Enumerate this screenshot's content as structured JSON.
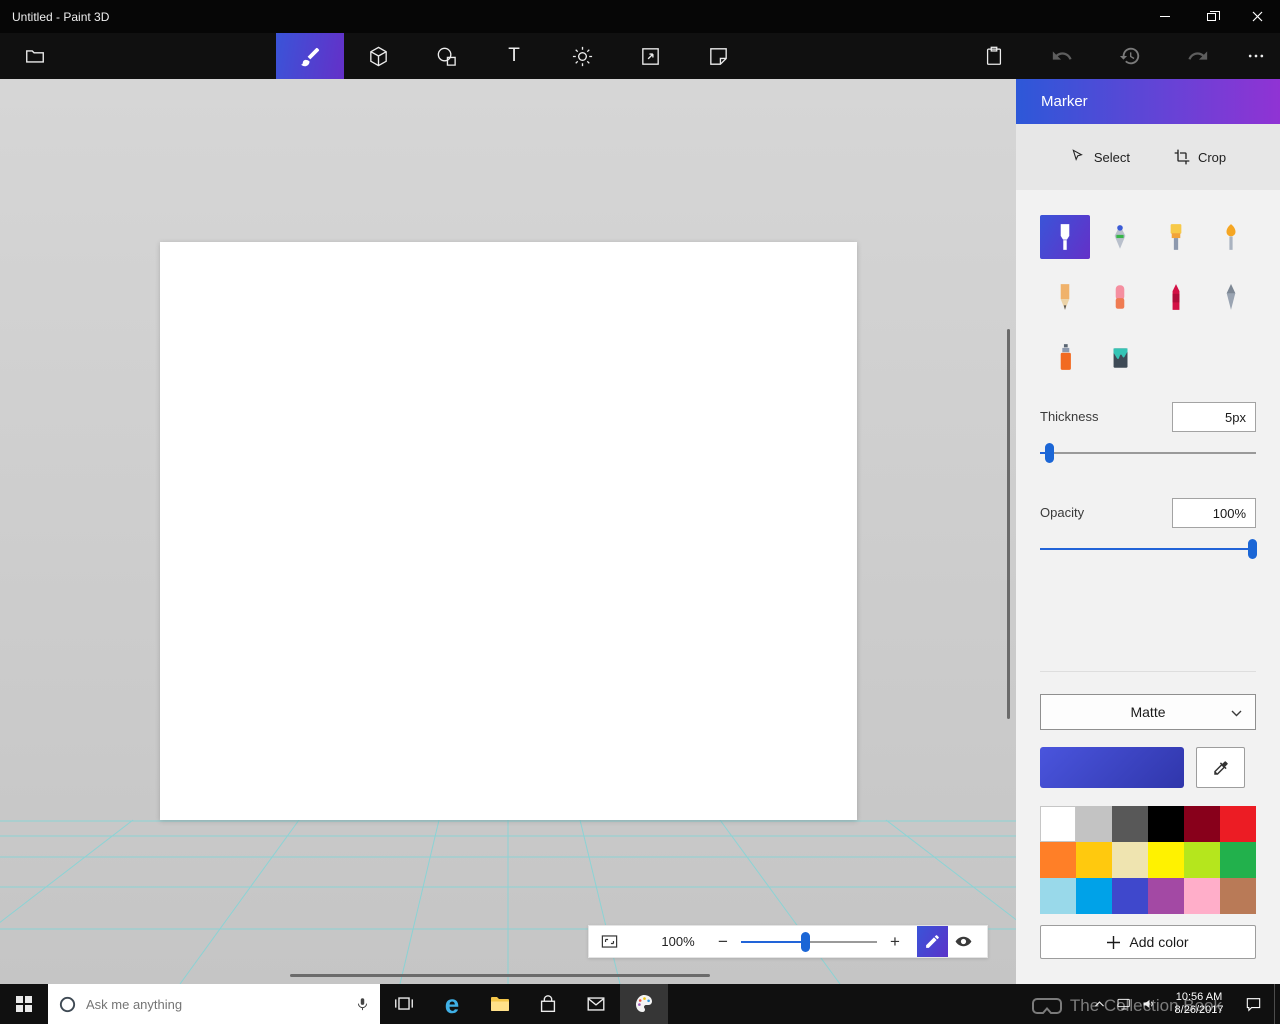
{
  "colors": {
    "accent_gradient_from": "#3a54d8",
    "accent_gradient_to": "#6430c8",
    "header_gradient_from": "#2d58d8",
    "header_gradient_to": "#9033d4",
    "current_color_from": "#4a55dd",
    "current_color_to": "#3036ab",
    "slider_accent": "#2264d8",
    "grid_line_color": "#52dfe2",
    "taskbar_bg": "#101010"
  },
  "titlebar": {
    "title": "Untitled - Paint 3D"
  },
  "toolbar": {
    "tools": [
      {
        "name": "Brushes",
        "selected": true
      },
      {
        "name": "3D shapes",
        "selected": false
      },
      {
        "name": "2D shapes",
        "selected": false
      },
      {
        "name": "Text",
        "selected": false
      },
      {
        "name": "Effects",
        "selected": false
      },
      {
        "name": "Canvas",
        "selected": false
      },
      {
        "name": "Stickers",
        "selected": false
      }
    ],
    "text_tool_glyph": "T",
    "actions": [
      "Paste",
      "Undo",
      "History",
      "Redo",
      "More"
    ]
  },
  "panel": {
    "title": "Marker",
    "select_label": "Select",
    "crop_label": "Crop",
    "brushes": [
      {
        "name": "Marker",
        "selected": true
      },
      {
        "name": "Calligraphy pen",
        "selected": false
      },
      {
        "name": "Oil brush",
        "selected": false
      },
      {
        "name": "Watercolour",
        "selected": false
      },
      {
        "name": "Pencil",
        "selected": false
      },
      {
        "name": "Eraser",
        "selected": false
      },
      {
        "name": "Crayon",
        "selected": false
      },
      {
        "name": "Pixel pen",
        "selected": false
      },
      {
        "name": "Spray can",
        "selected": false
      },
      {
        "name": "Fill",
        "selected": false
      }
    ],
    "thickness": {
      "label": "Thickness",
      "value": "5px",
      "percent": "4%"
    },
    "opacity": {
      "label": "Opacity",
      "value": "100%",
      "percent": "100%"
    },
    "finish": {
      "value": "Matte"
    },
    "palette": [
      {
        "name": "white",
        "hex": "#FFFFFF"
      },
      {
        "name": "light-grey",
        "hex": "#C3C3C3"
      },
      {
        "name": "dark-grey",
        "hex": "#585858"
      },
      {
        "name": "black",
        "hex": "#000000"
      },
      {
        "name": "dark-red",
        "hex": "#88001B"
      },
      {
        "name": "red",
        "hex": "#EC1C24"
      },
      {
        "name": "orange",
        "hex": "#FF7F27"
      },
      {
        "name": "gold",
        "hex": "#FFC90E"
      },
      {
        "name": "light-yellow",
        "hex": "#EFE4B0"
      },
      {
        "name": "yellow",
        "hex": "#FFF200"
      },
      {
        "name": "lime",
        "hex": "#B5E61D"
      },
      {
        "name": "green",
        "hex": "#22B14C"
      },
      {
        "name": "light-turquoise",
        "hex": "#99D9EA"
      },
      {
        "name": "turquoise",
        "hex": "#00A2E8"
      },
      {
        "name": "indigo",
        "hex": "#3F48CC"
      },
      {
        "name": "purple",
        "hex": "#A349A4"
      },
      {
        "name": "pink",
        "hex": "#FFAEC9"
      },
      {
        "name": "brown",
        "hex": "#B97A57"
      }
    ],
    "add_color_label": "Add color"
  },
  "zoombar": {
    "zoom_value": "100%",
    "minus": "−",
    "plus": "+",
    "slider_percent": "47%"
  },
  "taskbar": {
    "search_placeholder": "Ask me anything",
    "clock": {
      "time": "10:56 AM",
      "date": "8/26/2017"
    },
    "watermark": "The Collection Book"
  }
}
